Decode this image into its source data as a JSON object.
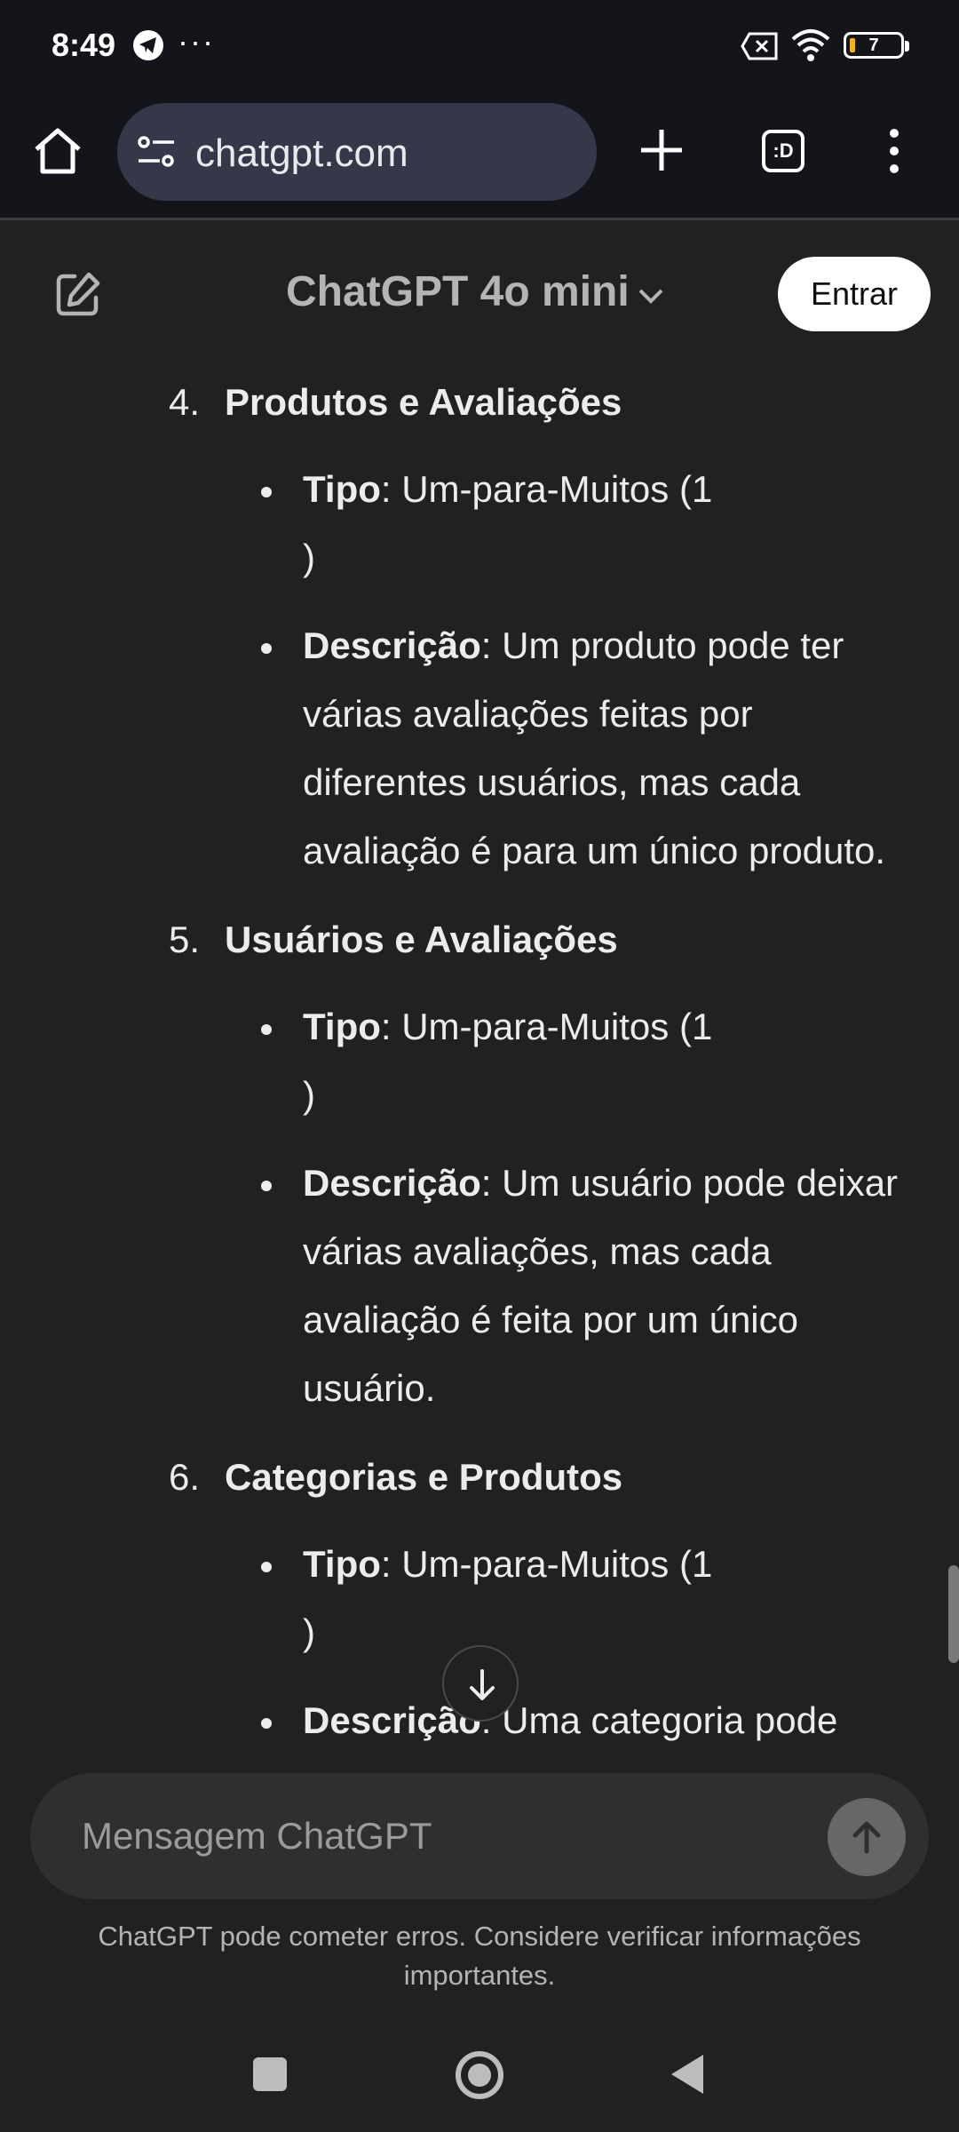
{
  "status_bar": {
    "time": "8:49",
    "dots": "···",
    "battery_level": "7",
    "icons": [
      "telegram-icon",
      "sim-disabled-icon",
      "wifi-icon",
      "battery-icon"
    ]
  },
  "browser": {
    "url": "chatgpt.com",
    "tabs_label": ":D",
    "icons": [
      "home-icon",
      "site-settings-icon",
      "new-tab-icon",
      "tabs-icon",
      "menu-icon"
    ]
  },
  "header": {
    "title": "ChatGPT 4o mini",
    "login_label": "Entrar"
  },
  "list": [
    {
      "number": "4.",
      "title": "Produtos e Avaliações",
      "bullets": [
        {
          "label": "Tipo",
          "lines": [
            ": Um-para-Muitos (1",
            ")"
          ]
        },
        {
          "label": "Descrição",
          "lines": [
            ": Um produto pode ter",
            "várias avaliações feitas por",
            "diferentes usuários, mas cada",
            "avaliação é para um único produto."
          ]
        }
      ]
    },
    {
      "number": "5.",
      "title": "Usuários e Avaliações",
      "bullets": [
        {
          "label": "Tipo",
          "lines": [
            ": Um-para-Muitos (1",
            ")"
          ]
        },
        {
          "label": "Descrição",
          "lines": [
            ": Um usuário pode deixar",
            "várias avaliações, mas cada",
            "avaliação é feita por um único",
            "usuário."
          ]
        }
      ]
    },
    {
      "number": "6.",
      "title": "Categorias e Produtos",
      "bullets": [
        {
          "label": "Tipo",
          "lines": [
            ": Um-para-Muitos (1",
            ")"
          ]
        },
        {
          "label": "Descrição",
          "lines": [
            ": Uma categoria pode"
          ]
        }
      ]
    }
  ],
  "composer": {
    "placeholder": "Mensagem ChatGPT"
  },
  "disclaimer": {
    "line1": "ChatGPT pode cometer erros. Considere verificar informações",
    "line2": "importantes."
  },
  "colors": {
    "background": "#212121",
    "system_bar": "#14151a",
    "url_pill": "#353849",
    "composer": "#2f2f2f",
    "text": "#ececec"
  }
}
